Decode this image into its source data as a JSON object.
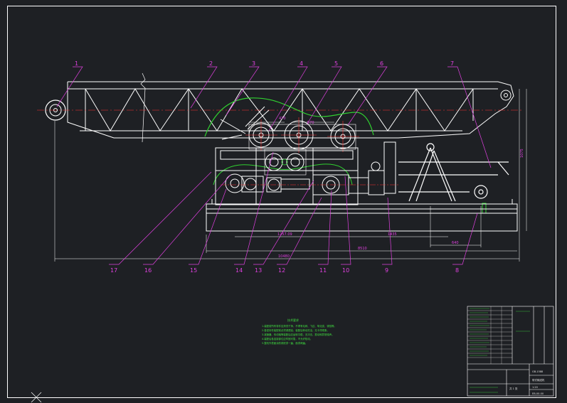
{
  "drawing": {
    "callouts": [
      "1",
      "2",
      "3",
      "4",
      "5",
      "6",
      "7",
      "8",
      "9",
      "10",
      "11",
      "12",
      "13",
      "14",
      "15",
      "16",
      "17"
    ],
    "dimensions": {
      "dim_top_a": "470",
      "dim_top_b": "570",
      "dim_right_height": "1075",
      "dim_lower_a": "1257.09",
      "dim_lower_b": "1435",
      "dim_lower_right": "640",
      "dim_total_mid": "8510",
      "dim_total_bottom": "10480"
    },
    "colors": {
      "background": "#1e2024",
      "outline": "#ffffff",
      "callout": "#e040e0",
      "centerline": "#ff3030",
      "cover": "#30d030",
      "notes": "#40e040"
    }
  },
  "tech_notes": {
    "title": "技术要求",
    "lines": [
      "1.装配前所有零件应清洗干净，不得有毛刺、飞边、氧化皮、锈蚀等。",
      "2.各密封件装配前必须浸透油，装配后转动灵活，无卡滞现象。",
      "3.减速器、传动轴等装配后应运转平稳，无冲击、振动和异常噪声。",
      "4.装配后各连接部位应牢固可靠，不允许松动。",
      "5.整机外表面涂防锈底漆一遍，面漆两遍。"
    ]
  },
  "title_block": {
    "drawing_number": "EB-00-00",
    "part_name": "带式输送机",
    "material_code": "GB-1588",
    "scale": "1:20",
    "sheet": "共 1 张"
  }
}
